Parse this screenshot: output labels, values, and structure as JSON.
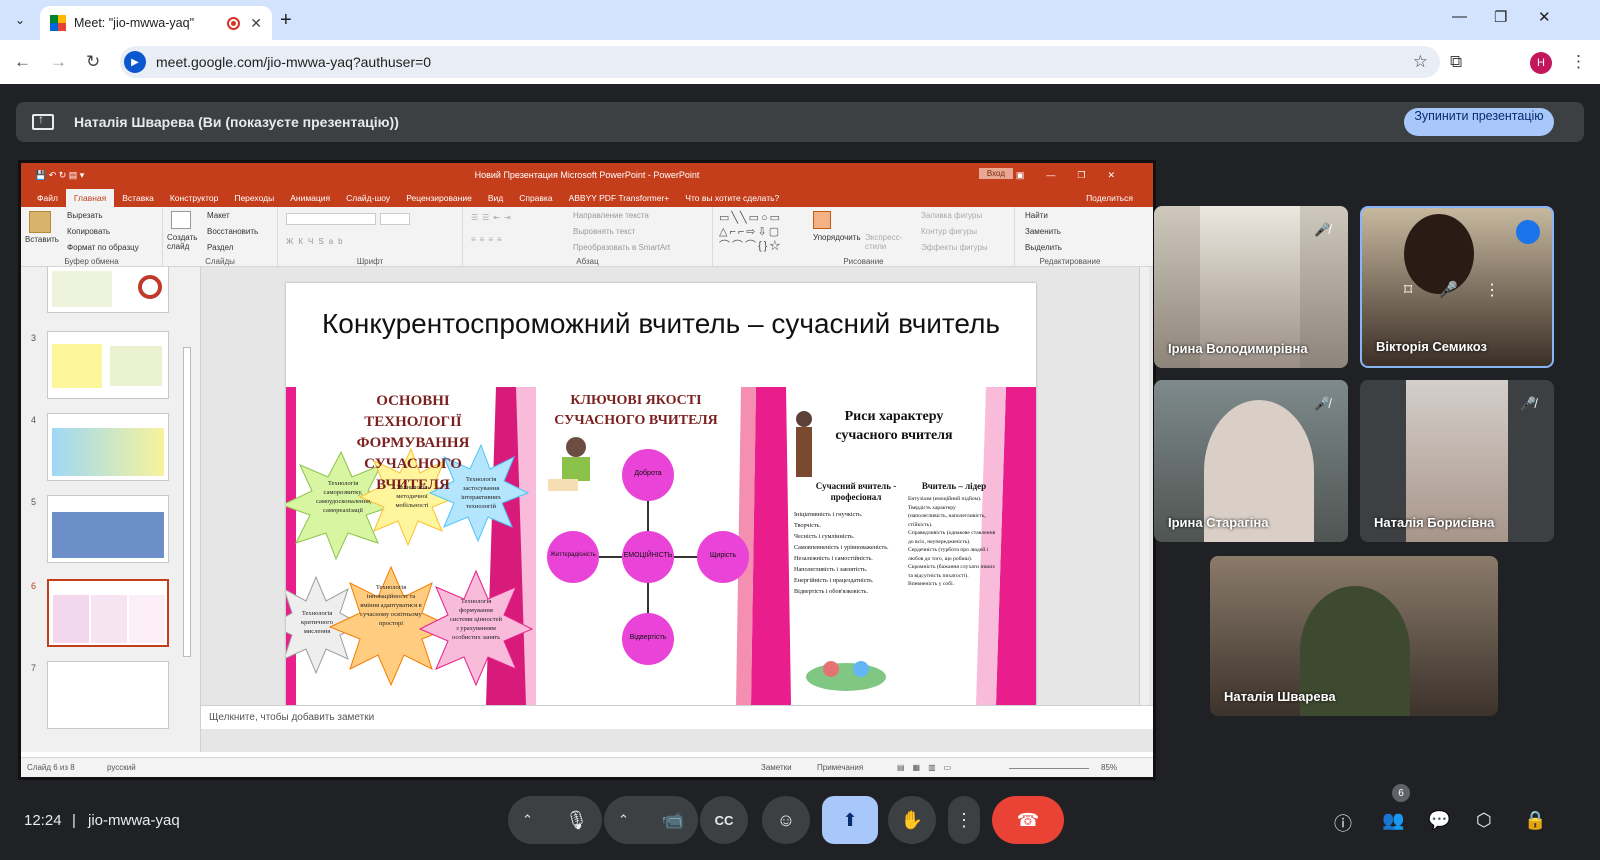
{
  "browser": {
    "tab_title": "Meet: \"jio-mwwa-yaq\"",
    "url": "meet.google.com/jio-mwwa-yaq?authuser=0",
    "profile_initial": "H"
  },
  "meet": {
    "presenting_banner": "Наталія Шварева (Ви (показуєте презентацію))",
    "stop_button": "Зупинити презентацію",
    "time": "12:24",
    "meeting_code": "jio-mwwa-yaq",
    "participants_count": "6",
    "participants": [
      {
        "name": "Ірина Володимирівна",
        "muted": true
      },
      {
        "name": "Вікторія Семикоз",
        "muted": false,
        "speaking": true
      },
      {
        "name": "Ірина Старагіна",
        "muted": true
      },
      {
        "name": "Наталія Борисівна",
        "muted": true
      },
      {
        "name": "Наталія Шварева",
        "muted": false
      }
    ]
  },
  "ppt": {
    "window_title": "Новий Презентация Microsoft PowerPoint - PowerPoint",
    "login": "Вход",
    "tabs": [
      "Файл",
      "Главная",
      "Вставка",
      "Конструктор",
      "Переходы",
      "Анимация",
      "Слайд-шоу",
      "Рецензирование",
      "Вид",
      "Справка",
      "ABBYY PDF Transformer+",
      "Что вы хотите сделать?"
    ],
    "share": "Поделиться",
    "ribbon": {
      "paste": "Вставить",
      "cut": "Вырезать",
      "copy": "Копировать",
      "format_painter": "Формат по образцу",
      "clipboard": "Буфер обмена",
      "new_slide": "Создать слайд",
      "layout": "Макет",
      "reset": "Восстановить",
      "section": "Раздел",
      "slides": "Слайды",
      "font": "Шрифт",
      "paragraph": "Абзац",
      "text_direction": "Направление текста",
      "align_text": "Выровнять текст",
      "smartart": "Преобразовать в SmartArt",
      "arrange": "Упорядочить",
      "quick_styles": "Экспресс-стили",
      "shape_fill": "Заливка фигуры",
      "shape_outline": "Контур фигуры",
      "shape_effects": "Эффекты фигуры",
      "drawing": "Рисование",
      "find": "Найти",
      "replace": "Заменить",
      "select": "Выделить",
      "editing": "Редактирование"
    },
    "thumbnail_numbers": [
      "3",
      "4",
      "5",
      "6",
      "7"
    ],
    "slide": {
      "title": "Конкурентоспроможний вчитель – сучасний вчитель",
      "col1_heading": "ОСНОВНІ ТЕХНОЛОГІЇ ФОРМУВАННЯ СУЧАСНОГО ВЧИТЕЛЯ",
      "col2_heading": "КЛЮЧОВІ ЯКОСТІ СУЧАСНОГО ВЧИТЕЛЯ",
      "col3_heading": "Риси характеру сучасного вчителя",
      "stars": [
        "Технологія саморозвитку, самоудосконалення, самореалізації",
        "Технологія методичної мобільності",
        "Технологія застосування інтерактивних технологій",
        "Технологія критичного мислення",
        "Технологія інноваційності та вміння адаптуватися в сучасному освітньому просторі",
        "Технологія формування системи цінностей з урахуванням особистих занять"
      ],
      "qualities": {
        "center": "ЕМОЦІЙНІСТЬ",
        "top": "Доброта",
        "left": "Життєрадісність",
        "right": "Щирість",
        "bottom": "Відвертість"
      },
      "prof_title": "Сучасний вчитель - професіонал",
      "prof_items": [
        "Ініціативність і гнучкість.",
        "Творчість.",
        "Чесність і сумлінність.",
        "Самовпевненість і урівноваженість.",
        "Незалежність і самостійність.",
        "Наполегливість і завзятість.",
        "Енергійність і працездатність.",
        "Відвертість і обов'язковість."
      ],
      "leader_title": "Вчитель – лідер",
      "leader_items": [
        "Ентузіазм (емоційний підйом).",
        "Твердість характеру (наполегливість, наполегливість, стійкість).",
        "Справедливість (однакове ставлення до всіх, неупередженість).",
        "Сердечність (турбота про людей і любов до того, що робиш).",
        "Скромність (бажання слухати інших та відсутність пихатості).",
        "Впевненість у собі."
      ]
    },
    "notes_placeholder": "Щелкните, чтобы добавить заметки",
    "status": {
      "slide_of": "Слайд 6 из 8",
      "language": "русский",
      "notes": "Заметки",
      "comments": "Примечания",
      "zoom": "85%"
    }
  },
  "colors": {
    "ppt_accent": "#c43e1c",
    "meet_bg": "#202124",
    "stop_btn": "#a8c7fa",
    "share_active": "#a8c7fa",
    "end_call": "#ea4335",
    "slide_magenta": "#e91e8c"
  }
}
